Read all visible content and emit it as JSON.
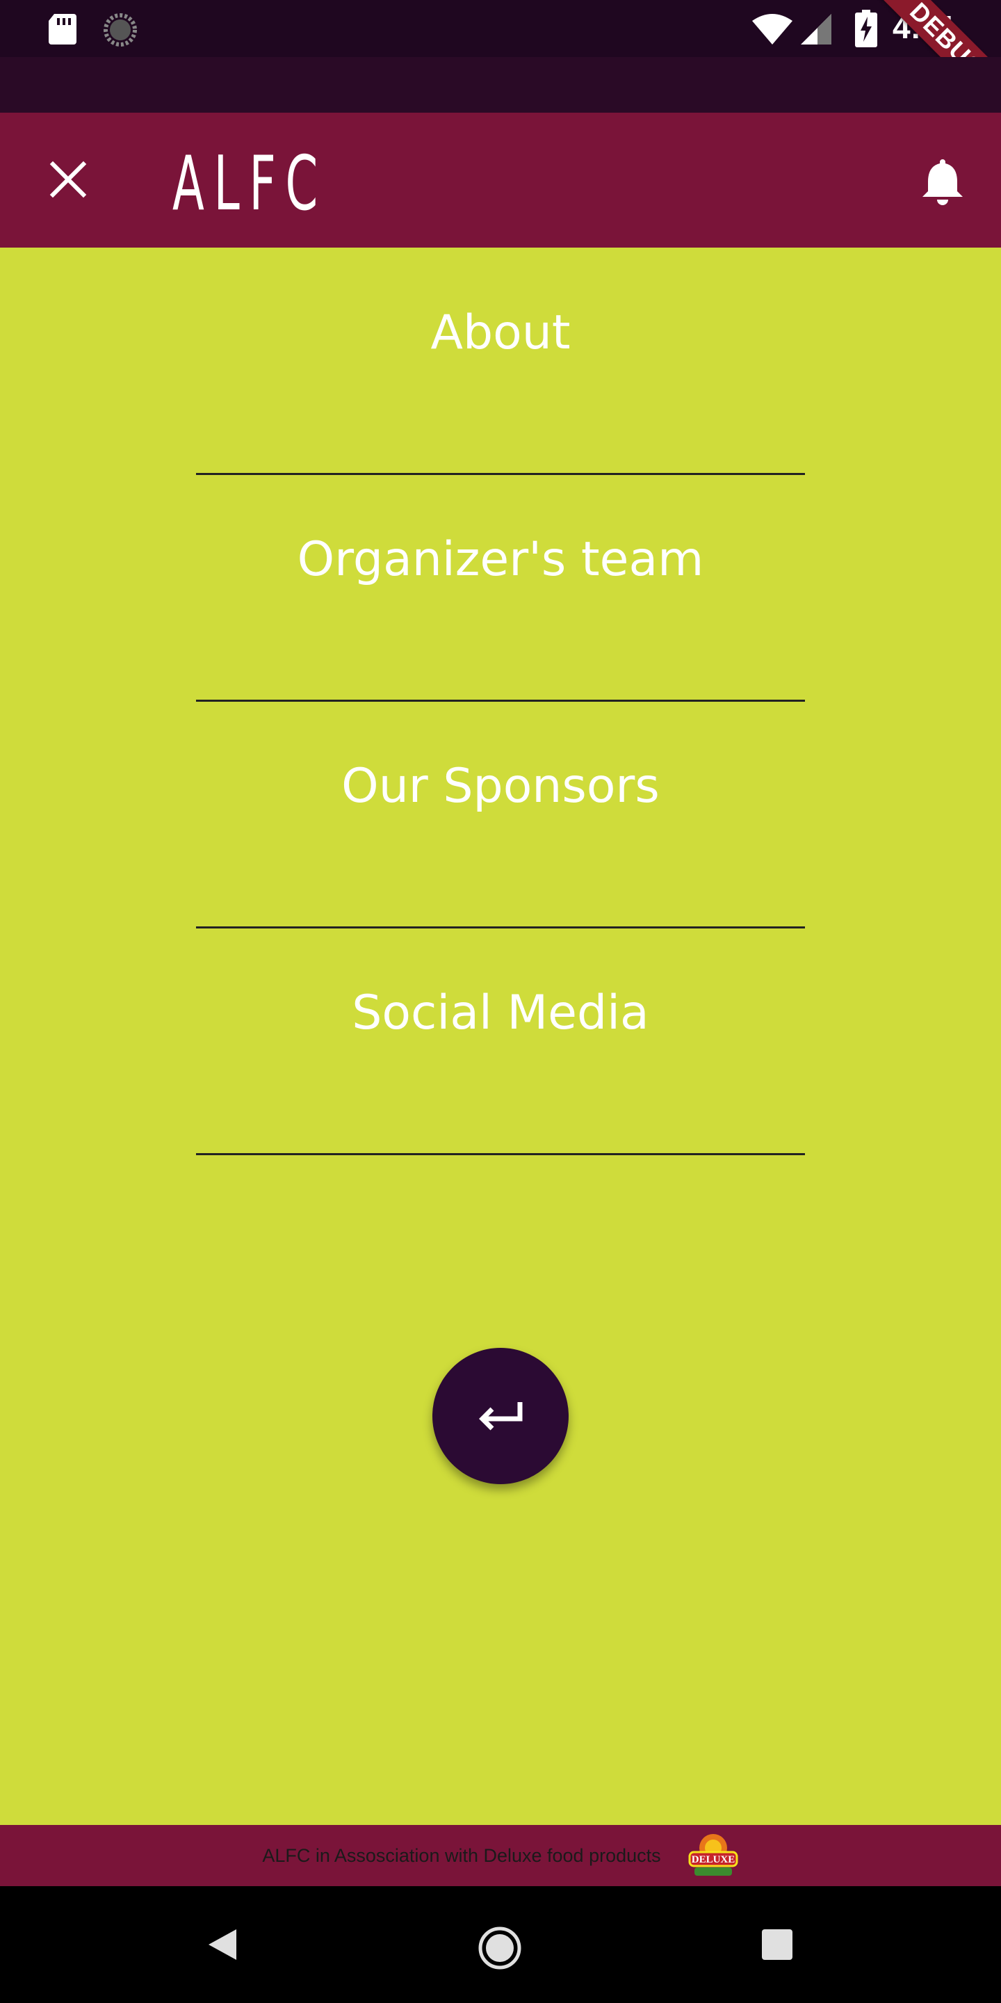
{
  "status_bar": {
    "time": "4:31",
    "debug_label": "DEBUG",
    "icons": [
      "sd-card-icon",
      "spinner-icon",
      "wifi-icon",
      "signal-icon",
      "battery-charging-icon"
    ]
  },
  "app_bar": {
    "title": "ALFC",
    "close_icon": "close-icon",
    "notification_icon": "bell-icon"
  },
  "menu": {
    "items": [
      {
        "label": "About"
      },
      {
        "label": "Organizer's team"
      },
      {
        "label": "Our Sponsors"
      },
      {
        "label": "Social Media"
      }
    ]
  },
  "fab": {
    "icon": "return-arrow-icon"
  },
  "footer": {
    "text": "ALFC in Assosciation with Deluxe food products",
    "logo_text": "DELUXE"
  },
  "colors": {
    "background": "#cfdc3b",
    "app_bar": "#7a1439",
    "status_bar": "#1f0720",
    "fab": "#2b0a33",
    "menu_text": "#ffffff",
    "divider": "#222222"
  }
}
